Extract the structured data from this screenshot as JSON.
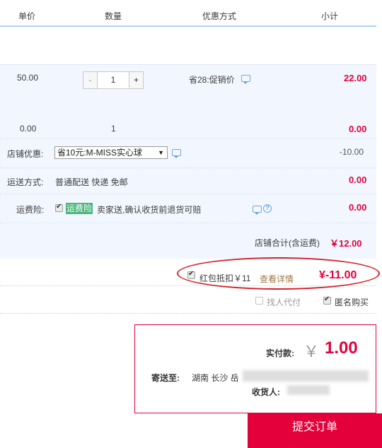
{
  "header": {
    "col_price": "单价",
    "col_qty": "数量",
    "col_discount": "优惠方式",
    "col_subtotal": "小计"
  },
  "item1": {
    "price": "50.00",
    "quantity": "1",
    "promo": "省28:促销价",
    "subtotal": "22.00",
    "minus": "-",
    "plus": "+"
  },
  "item2": {
    "price": "0.00",
    "quantity": "1",
    "subtotal": "0.00"
  },
  "shop_discount": {
    "label": "店铺优惠:",
    "selected": "省10元:M-MISS实心球",
    "value": "-10.00"
  },
  "shipping": {
    "label": "运送方式:",
    "method": "普通配送 快递 免邮",
    "value": "0.00"
  },
  "insurance": {
    "label": "运费险:",
    "tag": "运费险",
    "desc": "卖家送,确认收货前退货可赔",
    "value": "0.00",
    "help": "?"
  },
  "shop_total": {
    "label": "店铺合计(含运费)",
    "value": "￥12.00"
  },
  "redpacket": {
    "label": "红包抵扣￥11",
    "details_link": "查看详情",
    "value": "¥-11.00"
  },
  "options": {
    "proxy": "找人代付",
    "anonymous": "匿名购买"
  },
  "payment": {
    "label": "实付款:",
    "currency": "￥",
    "amount": "1.00",
    "ship_to_label": "寄送至:",
    "ship_to_value": "湖南 长沙 岳",
    "receiver_label": "收货人:"
  },
  "submit": {
    "label": "提交订单"
  },
  "colors": {
    "accent": "#e4003a",
    "header_line": "#b2d1ff",
    "band": "#f2f7ff",
    "insurance_tag": "#4ab67a"
  }
}
